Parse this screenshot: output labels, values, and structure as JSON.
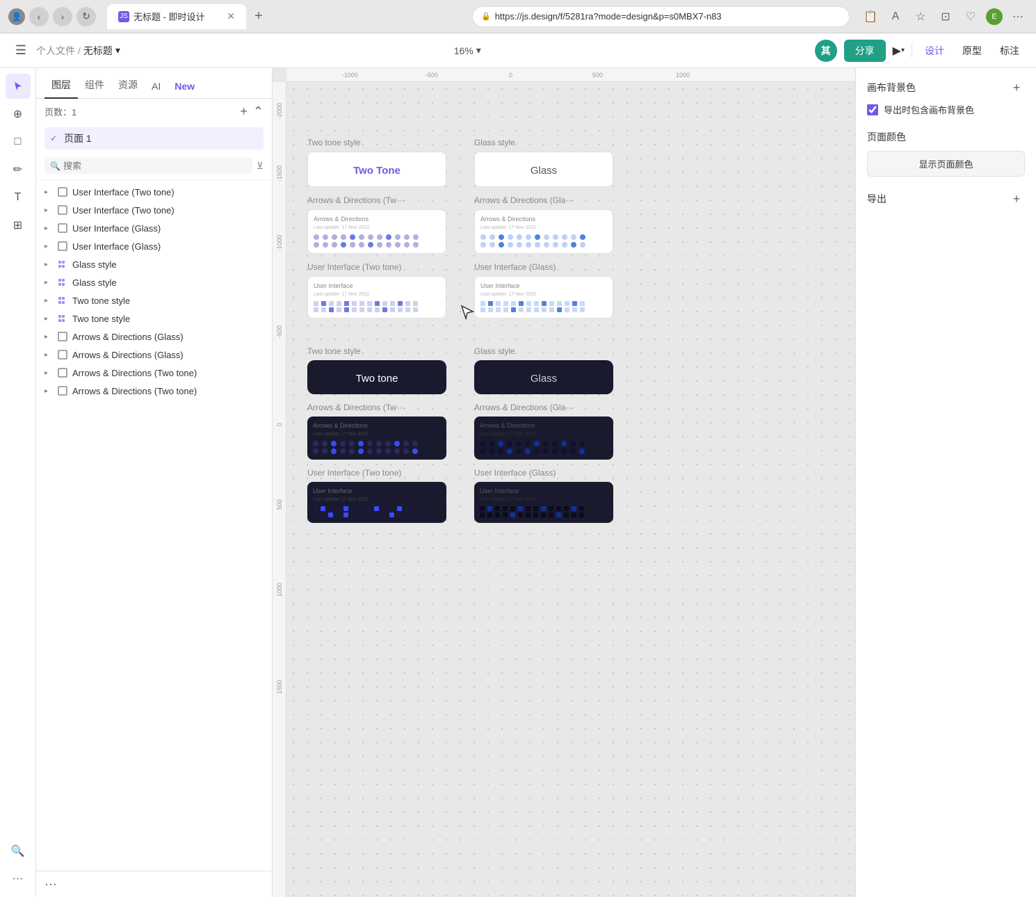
{
  "browser": {
    "back_btn": "←",
    "forward_btn": "→",
    "refresh_btn": "↻",
    "url": "https://js.design/f/5281ra?mode=design&p=s0MBX7-n83",
    "tab_title": "无标题 - 即时设计",
    "tab_favicon": "JS",
    "new_tab_btn": "+",
    "profile_icon": "👤"
  },
  "toolbar": {
    "hamburger": "☰",
    "breadcrumb_parent": "个人文件",
    "breadcrumb_sep": "/",
    "breadcrumb_current": "无标题",
    "breadcrumb_arrow": "▾",
    "zoom_level": "16%",
    "zoom_arrow": "▾",
    "share_label": "分享",
    "play_icon": "▶",
    "design_label": "设计",
    "prototype_label": "原型",
    "annotation_label": "标注",
    "user_initial": "其"
  },
  "sidebar": {
    "tabs": [
      {
        "label": "图层",
        "active": true
      },
      {
        "label": "组件",
        "active": false
      },
      {
        "label": "资源",
        "active": false
      },
      {
        "label": "AI",
        "active": false
      },
      {
        "label": "New",
        "active": false,
        "badge": true
      }
    ],
    "search_placeholder": "搜索",
    "pages_label": "页数：1",
    "pages": [
      {
        "label": "页面 1",
        "active": true
      }
    ],
    "layers": [
      {
        "type": "frame",
        "name": "User Interface (Two tone)",
        "indent": 0
      },
      {
        "type": "frame",
        "name": "User Interface (Two tone)",
        "indent": 0
      },
      {
        "type": "frame",
        "name": "User Interface (Glass)",
        "indent": 0
      },
      {
        "type": "frame",
        "name": "User Interface (Glass)",
        "indent": 0
      },
      {
        "type": "group",
        "name": "Glass style",
        "indent": 0
      },
      {
        "type": "group",
        "name": "Glass style",
        "indent": 0
      },
      {
        "type": "group",
        "name": "Two tone style",
        "indent": 0
      },
      {
        "type": "group",
        "name": "Two tone style",
        "indent": 0
      },
      {
        "type": "frame",
        "name": "Arrows & Directions (Glass)",
        "indent": 0
      },
      {
        "type": "frame",
        "name": "Arrows & Directions (Glass)",
        "indent": 0
      },
      {
        "type": "frame",
        "name": "Arrows & Directions (Two tone)",
        "indent": 0
      },
      {
        "type": "frame",
        "name": "Arrows & Directions (Two tone)",
        "indent": 0
      }
    ]
  },
  "canvas": {
    "ruler_ticks_h": [
      "-1000",
      "-500",
      "0",
      "500",
      "1000"
    ],
    "ruler_ticks_v": [
      "-2000",
      "-1500",
      "-1000",
      "-500",
      "0",
      "500",
      "1000",
      "1500"
    ]
  },
  "frames": {
    "top_row_light": [
      {
        "section_label": "Two tone style",
        "card_header": "Two Tone",
        "card_style": "light",
        "sub_label": "Arrows & Directions (Tw···",
        "sub_header": "Arrows & Directions",
        "sub_date": "Last update: 17 Nov 2022",
        "ui_label": "User Interface (Two tone)",
        "ui_header": "User Interface",
        "ui_date": "Last update: 17 Nov 2022"
      },
      {
        "section_label": "Glass style",
        "card_header": "Glass",
        "card_style": "glass-light",
        "sub_label": "Arrows & Directions (Gla···",
        "sub_header": "Arrows & Directions",
        "sub_date": "Last update: 17 Nov 2022",
        "ui_label": "User Interface (Glass)",
        "ui_header": "User Interface",
        "ui_date": "Last update: 17 Nov 2022"
      }
    ],
    "bottom_row_dark": [
      {
        "section_label": "Two tone style",
        "card_header": "Two tone",
        "card_style": "dark",
        "sub_label": "Arrows & Directions (Tw···",
        "sub_header": "Arrows & Directions",
        "sub_date": "Last update: 17 Nov 2022",
        "ui_label": "User Interface (Two tone)",
        "ui_header": "User Interface",
        "ui_date": "Last update: 17 Nov 2022"
      },
      {
        "section_label": "Glass style",
        "card_header": "Glass",
        "card_style": "dark",
        "sub_label": "Arrows & Directions (Gla···",
        "sub_header": "Arrows & Directions",
        "sub_date": "Last update: 17 Nov 2022",
        "ui_label": "User Interface (Glass)",
        "ui_header": "User Interface",
        "ui_date": "Last update: 17 Nov 2022"
      }
    ]
  },
  "right_panel": {
    "bg_color_title": "画布背景色",
    "add_btn": "+",
    "export_checkbox_label": "导出时包含画布背景色",
    "page_color_title": "页面颜色",
    "show_page_color_btn": "显示页面颜色",
    "export_title": "导出",
    "export_add_btn": "+"
  },
  "icons": {
    "search": "🔍",
    "arrow_down": "▾",
    "arrow_right": "▸",
    "frame": "⊞",
    "group": "≡",
    "cursor": "cursor",
    "move": "✥",
    "frame_tool": "□",
    "pen": "✏",
    "text": "T",
    "hand": "✋",
    "zoom": "🔍",
    "more": "···"
  }
}
